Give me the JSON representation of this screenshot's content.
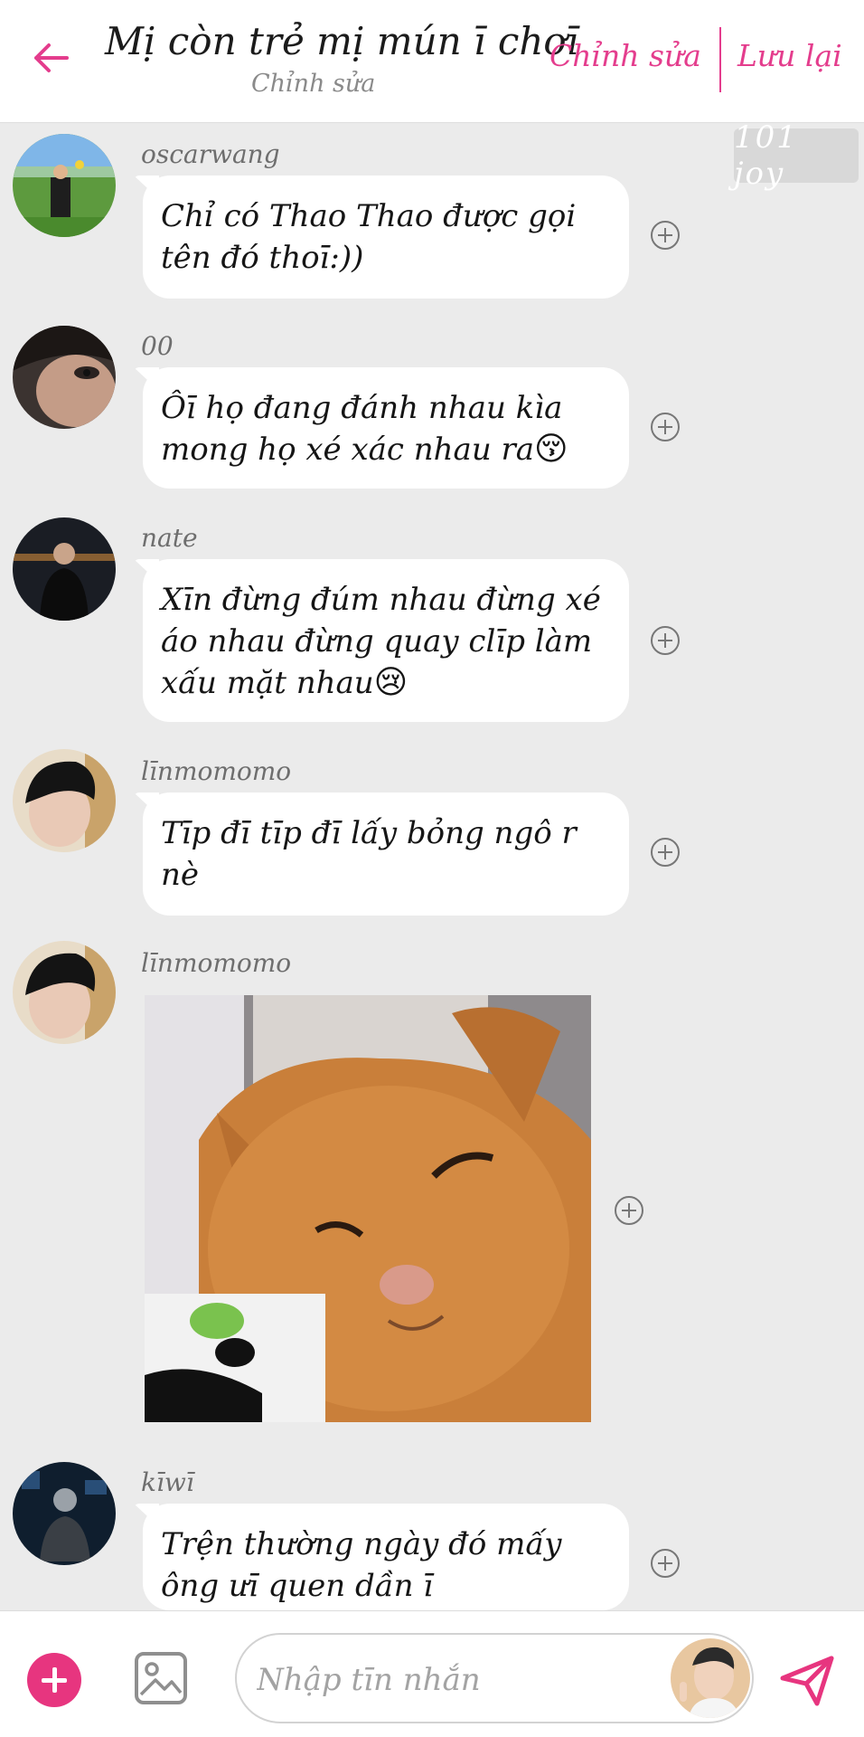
{
  "header": {
    "back_icon": "arrow-left-icon",
    "title": "Mị còn trẻ mị mún ī chơī",
    "subtitle": "Chỉnh sửa",
    "edit_label": "Chỉnh sửa",
    "save_label": "Lưu lại",
    "accent_color": "#e43d8d"
  },
  "badge": {
    "text": "101 joy"
  },
  "messages": [
    {
      "sender": "oscarwang",
      "text": "Chỉ có Thao Thao được gọi tên đó thoī:))"
    },
    {
      "sender": "00",
      "text": "Ôī họ đang đánh nhau kìa mong họ xé xác nhau ra",
      "emoji": "😚"
    },
    {
      "sender": "nate",
      "text": "Xīn đừng đúm nhau đừng xé áo nhau đừng quay clīp làm xấu mặt nhau",
      "emoji": "😢"
    },
    {
      "sender": "līnmomomo",
      "text": "Tīp đī tīp đī lấy bỏng ngô r nè"
    },
    {
      "sender": "līnmomomo",
      "type": "image",
      "image": "smug-cat-photo"
    },
    {
      "sender": "kīwī",
      "text": "Trện thường ngày đó mấy ông ưī quen dần ī"
    }
  ],
  "composer": {
    "add_icon": "plus-icon",
    "image_icon": "image-icon",
    "placeholder": "Nhập tīn nhắn",
    "send_icon": "send-icon"
  }
}
